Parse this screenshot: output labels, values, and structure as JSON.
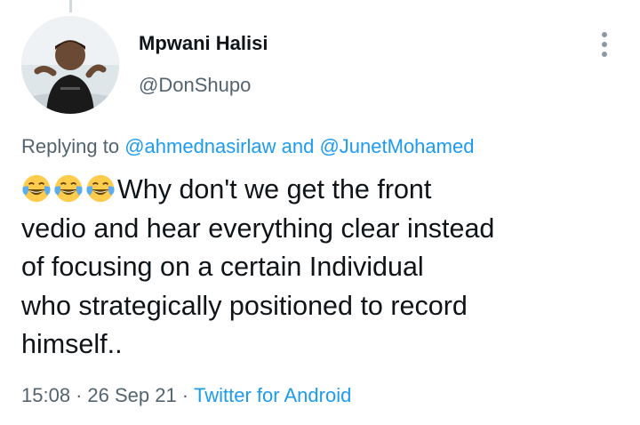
{
  "tweet": {
    "author": {
      "display_name": "Mpwani Halisi",
      "handle": "@DonShupo",
      "avatar": "avatar"
    },
    "more_icon": "more-vertical-icon",
    "replying_prefix": "Replying to",
    "replying_to": [
      "@ahmednasirlaw",
      "@JunetMohamed"
    ],
    "replying_joiner": "and",
    "emojis": [
      "face-with-tears-of-joy",
      "face-with-tears-of-joy",
      "face-with-tears-of-joy"
    ],
    "text_lines": [
      "Why don't we get the front",
      "vedio and hear everything clear instead",
      "of focusing on a certain Individual",
      "who strategically positioned to record",
      "himself.."
    ],
    "time": "15:08",
    "date": "26 Sep 21",
    "separator": "·",
    "source": "Twitter for Android"
  },
  "colors": {
    "link": "#1d9bf0",
    "secondary_text": "#536471",
    "primary_text": "#0f1419"
  }
}
